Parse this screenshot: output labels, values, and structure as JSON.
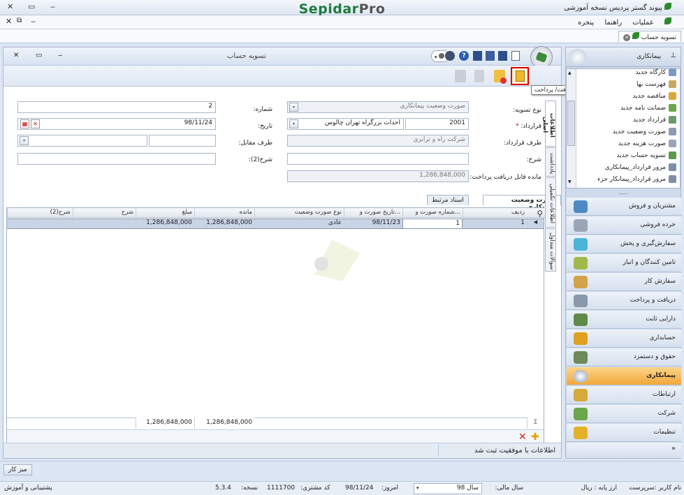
{
  "app": {
    "title": "پیوند گستر پردیس نسخه آموزشی",
    "brand_main": "Sepidar",
    "brand_pro": "Pro"
  },
  "menu": {
    "items": [
      "عملیات",
      "راهنما",
      "پنجره"
    ]
  },
  "doc_tab": {
    "label": "تسویه حساب"
  },
  "window": {
    "title": "تسویه حساب"
  },
  "tooltip": "صدور دریافت/ پرداخت",
  "form": {
    "settlement_type_label": "نوع تسویه:",
    "settlement_type_value": "صورت وضعیت پیمانکاری",
    "number_label": "شماره:",
    "number_value": "2",
    "contract_label": "قرارداد:",
    "contract_code": "2001",
    "contract_name": "احداث بزرگراه تهران چالوس",
    "required_mark": "*",
    "date_label": "تاریخ:",
    "date_value": "98/11/24",
    "party_label": "طرف قرارداد:",
    "party_value": "شرکت راه و ترابری",
    "counterparty_label": "طرف مقابل:",
    "desc_label": "شرح:",
    "desc2_label": "شرح(2):",
    "remaining_label": "مانده قابل دریافت پرداخت:",
    "remaining_value": "1,286,848,000"
  },
  "subtabs": {
    "active": "صورت وضعیت پیمانکاری",
    "other": "اسناد مرتبط"
  },
  "vertical_tabs": [
    "اطلاعات اصلی",
    "یادداشت",
    "اطلاعات تکمیلی",
    "سوالات متداول"
  ],
  "grid": {
    "headers": [
      "ردیف",
      "شماره صورت و...",
      "تاریخ صورت و...",
      "نوع صورت وضعیت",
      "مانده",
      "مبلغ",
      "شرح",
      "شرح(2)"
    ],
    "rows": [
      [
        "1",
        "1",
        "98/11/23",
        "عادی",
        "1,286,848,000",
        "1,286,848,000",
        "",
        ""
      ]
    ],
    "footer": {
      "sigma": "Σ",
      "remain_total": "1,286,848,000",
      "amount_total": "1,286,848,000"
    }
  },
  "message": "اطلاعات با موفقیت ثبت شد",
  "desktop_button": "میز کار",
  "sidebar": {
    "header": "پیمانکاری",
    "tree_items": [
      "کارگاه جدید",
      "فهرست بها",
      "مناقصه جدید",
      "ضمانت نامه جدید",
      "قرارداد جدید",
      "صورت وضعیت جدید",
      "صورت هزینه جدید",
      "تسویه حساب جدید",
      "مرور قرارداد_پیمانکاری",
      "مرور قرارداد_پیمانکار جزء"
    ],
    "nav": [
      "مشتریان و فروش",
      "خرده فروشی",
      "سفارش‌گیری و پخش",
      "تامین کنندگان و انبار",
      "سفارش کار",
      "دریافت و پرداخت",
      "دارایی ثابت",
      "حسابداری",
      "حقوق و دستمزد",
      "پیمانکاری",
      "ارتباطات",
      "شرکت",
      "تنظیمات"
    ],
    "active_index": 9,
    "dots": "....."
  },
  "status": {
    "user": "نام کاربر :سرپرست",
    "currency": "ارز پایه : ریال",
    "fiscal_label": "سال مالی:",
    "fiscal_value": "سال 98",
    "today_label": "امروز:",
    "today_value": "98/11/24",
    "customer_label": "کد مشتری:",
    "customer_value": "1111700",
    "version_label": "نسخه:",
    "version_value": "5.3.4",
    "support": "پشتیبانی و آموزش"
  },
  "colors": {
    "brand": "#1f7a3e",
    "active_nav": "#f2a73b",
    "highlight": "#cc0000"
  }
}
